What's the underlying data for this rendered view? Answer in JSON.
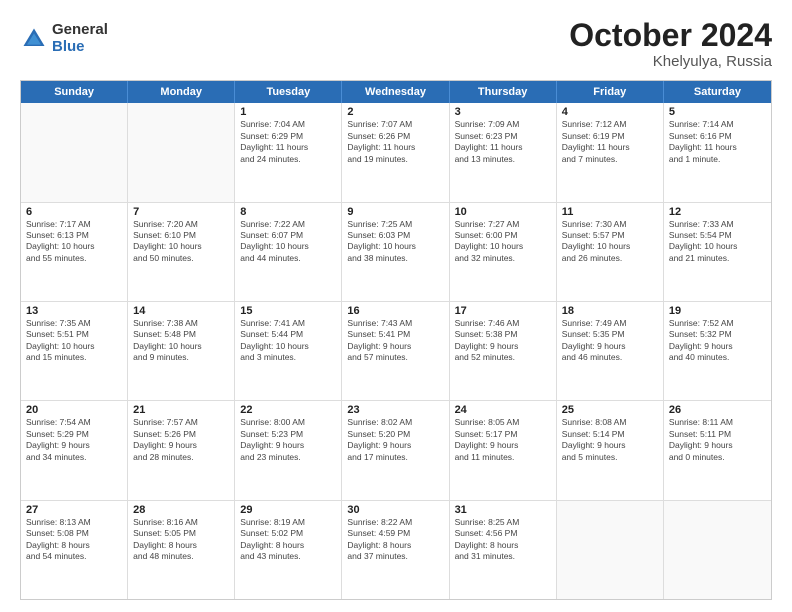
{
  "logo": {
    "general": "General",
    "blue": "Blue"
  },
  "title": "October 2024",
  "subtitle": "Khelyulya, Russia",
  "header_days": [
    "Sunday",
    "Monday",
    "Tuesday",
    "Wednesday",
    "Thursday",
    "Friday",
    "Saturday"
  ],
  "weeks": [
    [
      {
        "day": "",
        "detail": ""
      },
      {
        "day": "",
        "detail": ""
      },
      {
        "day": "1",
        "detail": "Sunrise: 7:04 AM\nSunset: 6:29 PM\nDaylight: 11 hours\nand 24 minutes."
      },
      {
        "day": "2",
        "detail": "Sunrise: 7:07 AM\nSunset: 6:26 PM\nDaylight: 11 hours\nand 19 minutes."
      },
      {
        "day": "3",
        "detail": "Sunrise: 7:09 AM\nSunset: 6:23 PM\nDaylight: 11 hours\nand 13 minutes."
      },
      {
        "day": "4",
        "detail": "Sunrise: 7:12 AM\nSunset: 6:19 PM\nDaylight: 11 hours\nand 7 minutes."
      },
      {
        "day": "5",
        "detail": "Sunrise: 7:14 AM\nSunset: 6:16 PM\nDaylight: 11 hours\nand 1 minute."
      }
    ],
    [
      {
        "day": "6",
        "detail": "Sunrise: 7:17 AM\nSunset: 6:13 PM\nDaylight: 10 hours\nand 55 minutes."
      },
      {
        "day": "7",
        "detail": "Sunrise: 7:20 AM\nSunset: 6:10 PM\nDaylight: 10 hours\nand 50 minutes."
      },
      {
        "day": "8",
        "detail": "Sunrise: 7:22 AM\nSunset: 6:07 PM\nDaylight: 10 hours\nand 44 minutes."
      },
      {
        "day": "9",
        "detail": "Sunrise: 7:25 AM\nSunset: 6:03 PM\nDaylight: 10 hours\nand 38 minutes."
      },
      {
        "day": "10",
        "detail": "Sunrise: 7:27 AM\nSunset: 6:00 PM\nDaylight: 10 hours\nand 32 minutes."
      },
      {
        "day": "11",
        "detail": "Sunrise: 7:30 AM\nSunset: 5:57 PM\nDaylight: 10 hours\nand 26 minutes."
      },
      {
        "day": "12",
        "detail": "Sunrise: 7:33 AM\nSunset: 5:54 PM\nDaylight: 10 hours\nand 21 minutes."
      }
    ],
    [
      {
        "day": "13",
        "detail": "Sunrise: 7:35 AM\nSunset: 5:51 PM\nDaylight: 10 hours\nand 15 minutes."
      },
      {
        "day": "14",
        "detail": "Sunrise: 7:38 AM\nSunset: 5:48 PM\nDaylight: 10 hours\nand 9 minutes."
      },
      {
        "day": "15",
        "detail": "Sunrise: 7:41 AM\nSunset: 5:44 PM\nDaylight: 10 hours\nand 3 minutes."
      },
      {
        "day": "16",
        "detail": "Sunrise: 7:43 AM\nSunset: 5:41 PM\nDaylight: 9 hours\nand 57 minutes."
      },
      {
        "day": "17",
        "detail": "Sunrise: 7:46 AM\nSunset: 5:38 PM\nDaylight: 9 hours\nand 52 minutes."
      },
      {
        "day": "18",
        "detail": "Sunrise: 7:49 AM\nSunset: 5:35 PM\nDaylight: 9 hours\nand 46 minutes."
      },
      {
        "day": "19",
        "detail": "Sunrise: 7:52 AM\nSunset: 5:32 PM\nDaylight: 9 hours\nand 40 minutes."
      }
    ],
    [
      {
        "day": "20",
        "detail": "Sunrise: 7:54 AM\nSunset: 5:29 PM\nDaylight: 9 hours\nand 34 minutes."
      },
      {
        "day": "21",
        "detail": "Sunrise: 7:57 AM\nSunset: 5:26 PM\nDaylight: 9 hours\nand 28 minutes."
      },
      {
        "day": "22",
        "detail": "Sunrise: 8:00 AM\nSunset: 5:23 PM\nDaylight: 9 hours\nand 23 minutes."
      },
      {
        "day": "23",
        "detail": "Sunrise: 8:02 AM\nSunset: 5:20 PM\nDaylight: 9 hours\nand 17 minutes."
      },
      {
        "day": "24",
        "detail": "Sunrise: 8:05 AM\nSunset: 5:17 PM\nDaylight: 9 hours\nand 11 minutes."
      },
      {
        "day": "25",
        "detail": "Sunrise: 8:08 AM\nSunset: 5:14 PM\nDaylight: 9 hours\nand 5 minutes."
      },
      {
        "day": "26",
        "detail": "Sunrise: 8:11 AM\nSunset: 5:11 PM\nDaylight: 9 hours\nand 0 minutes."
      }
    ],
    [
      {
        "day": "27",
        "detail": "Sunrise: 8:13 AM\nSunset: 5:08 PM\nDaylight: 8 hours\nand 54 minutes."
      },
      {
        "day": "28",
        "detail": "Sunrise: 8:16 AM\nSunset: 5:05 PM\nDaylight: 8 hours\nand 48 minutes."
      },
      {
        "day": "29",
        "detail": "Sunrise: 8:19 AM\nSunset: 5:02 PM\nDaylight: 8 hours\nand 43 minutes."
      },
      {
        "day": "30",
        "detail": "Sunrise: 8:22 AM\nSunset: 4:59 PM\nDaylight: 8 hours\nand 37 minutes."
      },
      {
        "day": "31",
        "detail": "Sunrise: 8:25 AM\nSunset: 4:56 PM\nDaylight: 8 hours\nand 31 minutes."
      },
      {
        "day": "",
        "detail": ""
      },
      {
        "day": "",
        "detail": ""
      }
    ]
  ]
}
